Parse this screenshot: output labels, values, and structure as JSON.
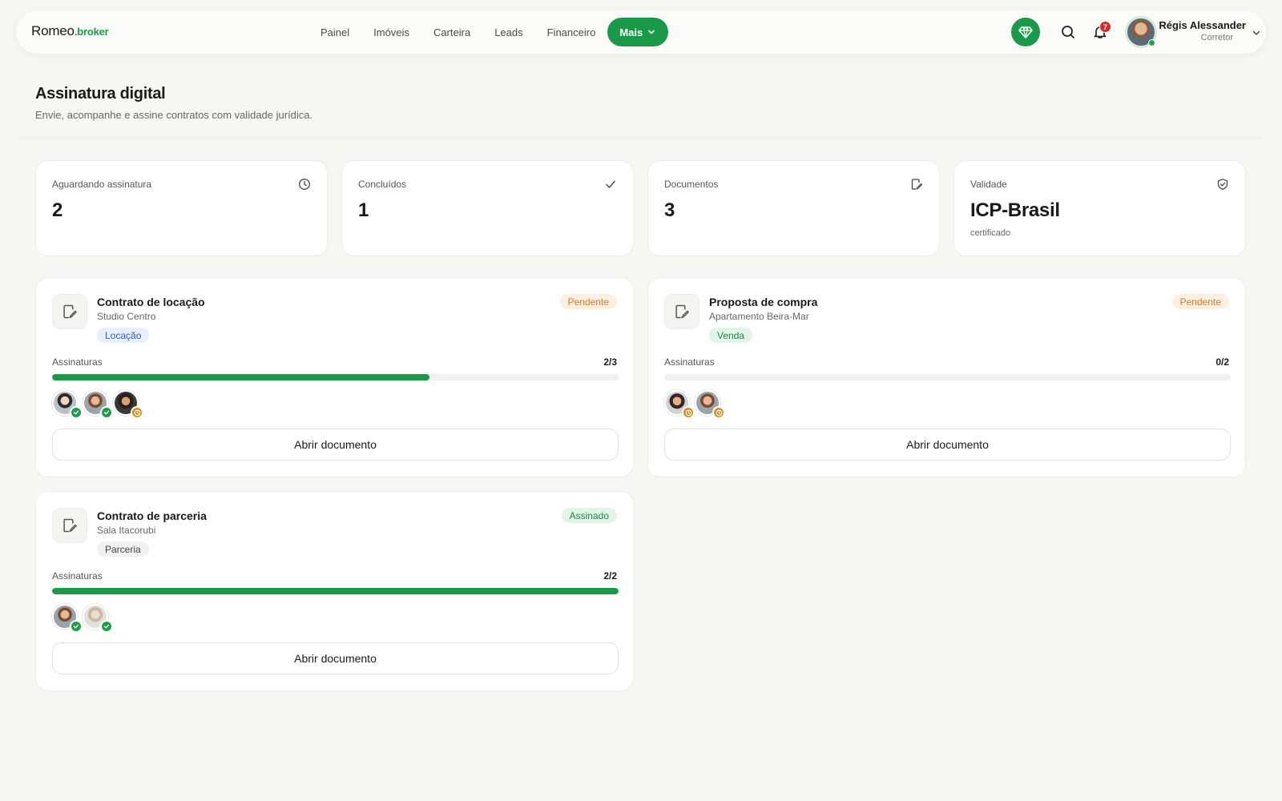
{
  "brand": {
    "name_part1": "Romeo",
    "name_part2": ".broker"
  },
  "nav": {
    "items": [
      "Painel",
      "Imóveis",
      "Carteira",
      "Leads",
      "Financeiro"
    ],
    "more_label": "Mais"
  },
  "notifications": {
    "count": "7"
  },
  "user": {
    "name": "Régis Alessander",
    "role": "Corretor"
  },
  "page": {
    "title": "Assinatura digital",
    "subtitle": "Envie, acompanhe e assine contratos com validade jurídica."
  },
  "stats": [
    {
      "label": "Aguardando assinatura",
      "value": "2",
      "note": "",
      "icon": "clock-icon"
    },
    {
      "label": "Concluídos",
      "value": "1",
      "note": "",
      "icon": "check-icon"
    },
    {
      "label": "Documentos",
      "value": "3",
      "note": "",
      "icon": "document-edit-icon"
    },
    {
      "label": "Validade",
      "value": "ICP-Brasil",
      "note": "certificado",
      "icon": "shield-check-icon"
    }
  ],
  "documents": [
    {
      "title": "Contrato de locação",
      "subtitle": "Studio Centro",
      "tag": "Locação",
      "tag_color": "blue",
      "status": "Pendente",
      "status_type": "pending",
      "signatures_label": "Assinaturas",
      "signatures_done": 2,
      "signatures_total": 3,
      "signatures_text": "2/3",
      "signers": [
        "signed",
        "signed",
        "waiting"
      ],
      "button_label": "Abrir documento"
    },
    {
      "title": "Proposta de compra",
      "subtitle": "Apartamento Beira-Mar",
      "tag": "Venda",
      "tag_color": "green",
      "status": "Pendente",
      "status_type": "pending",
      "signatures_label": "Assinaturas",
      "signatures_done": 0,
      "signatures_total": 2,
      "signatures_text": "0/2",
      "signers": [
        "waiting",
        "waiting"
      ],
      "button_label": "Abrir documento"
    },
    {
      "title": "Contrato de parceria",
      "subtitle": "Sala Itacorubi",
      "tag": "Parceria",
      "tag_color": "gray",
      "status": "Assinado",
      "status_type": "signed",
      "signatures_label": "Assinaturas",
      "signatures_done": 2,
      "signatures_total": 2,
      "signatures_text": "2/2",
      "signers": [
        "signed",
        "signed"
      ],
      "button_label": "Abrir documento"
    }
  ],
  "colors": {
    "accent": "#1a9a48",
    "pending": "#d9791a",
    "badge": "#d9262b"
  }
}
